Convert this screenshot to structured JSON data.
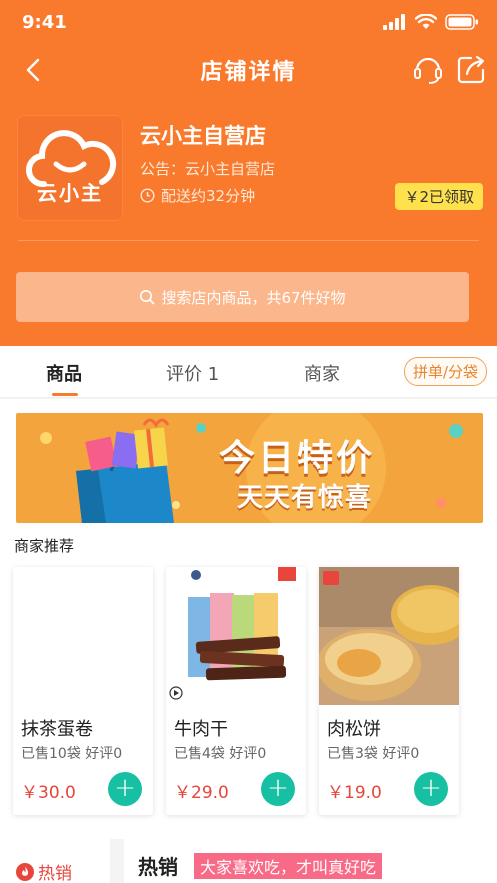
{
  "status_bar": {
    "time": "9:41"
  },
  "nav": {
    "title": "店铺详情"
  },
  "shop": {
    "logo_text": "云小主",
    "name": "云小主自营店",
    "notice": "公告：云小主自营店",
    "delivery": "配送约32分钟",
    "coupon": "￥2已领取"
  },
  "search": {
    "placeholder": "搜索店内商品，共67件好物"
  },
  "tabs": [
    {
      "label": "商品",
      "active": true
    },
    {
      "label": "评价 1",
      "active": false
    },
    {
      "label": "商家",
      "active": false
    }
  ],
  "group_button": "拼单/分袋",
  "banner": {
    "line1": "今日特价",
    "line2": "天天有惊喜"
  },
  "recommend_title": "商家推荐",
  "products": [
    {
      "name": "抹茶蛋卷",
      "sold": "已售10袋",
      "reviews": "好评0",
      "price": "￥30.0"
    },
    {
      "name": "牛肉干",
      "sold": "已售4袋",
      "reviews": "好评0",
      "price": "￥29.0"
    },
    {
      "name": "肉松饼",
      "sold": "已售3袋",
      "reviews": "好评0",
      "price": "￥19.0"
    }
  ],
  "category": {
    "hot_label": "热销"
  },
  "section": {
    "title": "热销",
    "slogan": "大家喜欢吃，才叫真好吃"
  },
  "colors": {
    "brand": "#f97a2c",
    "accent": "#17c0a3",
    "price": "#e8453c",
    "coupon": "#ffe14d"
  }
}
